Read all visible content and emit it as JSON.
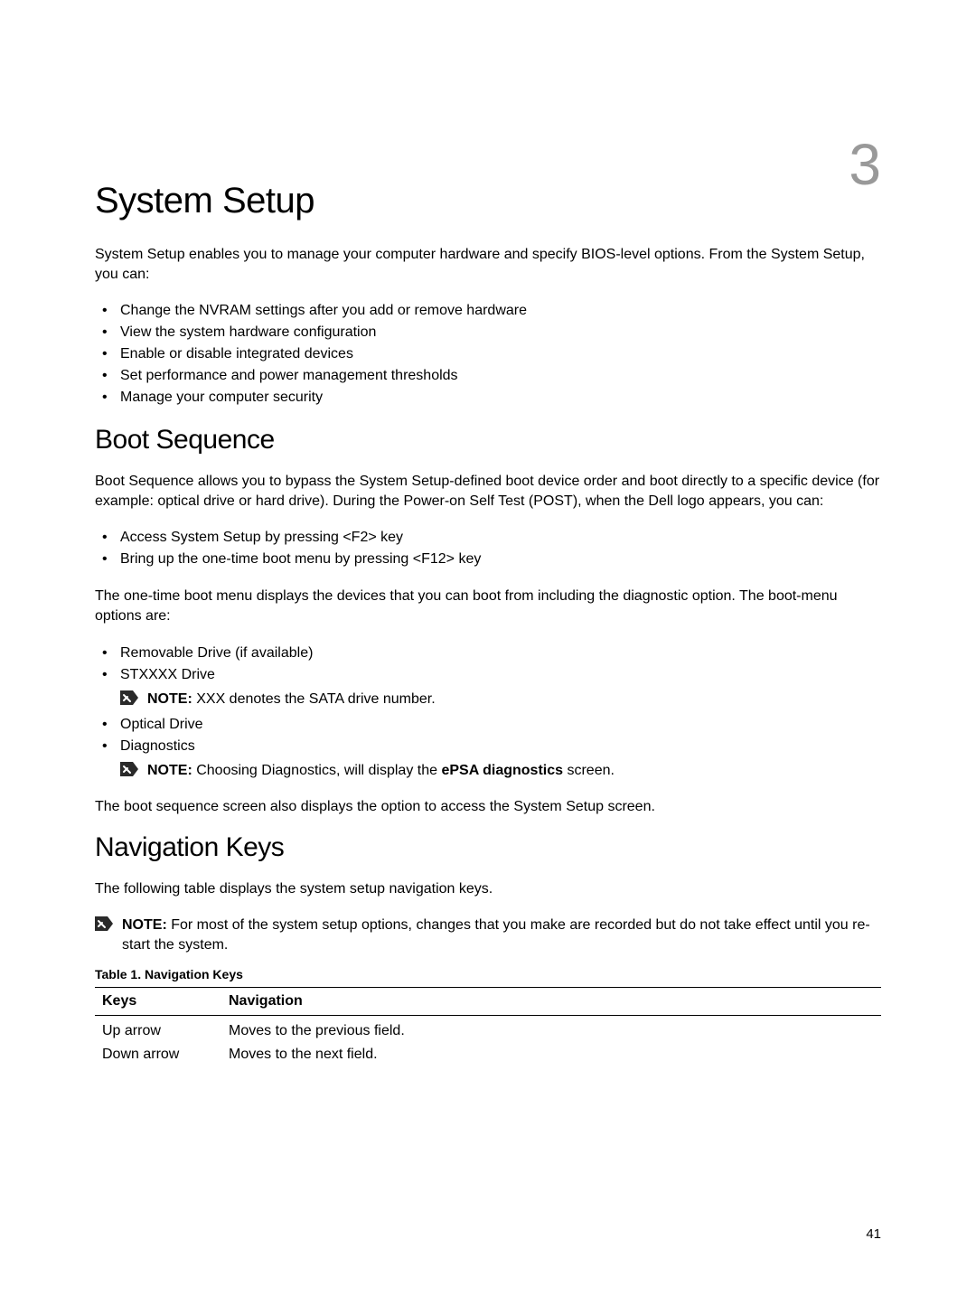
{
  "chapterNumber": "3",
  "chapterTitle": "System Setup",
  "introPara": "System Setup enables you to manage your computer hardware and specify BIOS-level options. From the System Setup, you can:",
  "introBullets": [
    "Change the NVRAM settings after you add or remove hardware",
    "View the system hardware configuration",
    "Enable or disable integrated devices",
    "Set performance and power management thresholds",
    "Manage your computer security"
  ],
  "bootSequence": {
    "heading": "Boot Sequence",
    "para1": "Boot Sequence allows you to bypass the System Setup-defined boot device order and boot directly to a specific device (for example: optical drive or hard drive). During the Power-on Self Test (POST), when the Dell logo appears, you can:",
    "bullets1": [
      "Access System Setup by pressing <F2> key",
      "Bring up the one-time boot menu by pressing <F12> key"
    ],
    "para2": "The one-time boot menu displays the devices that you can boot from including the diagnostic option. The boot-menu options are:",
    "bullets2": {
      "item1": "Removable Drive (if available)",
      "item2": "STXXXX Drive",
      "note1Label": "NOTE: ",
      "note1Text": "XXX denotes the SATA drive number.",
      "item3": "Optical Drive",
      "item4": "Diagnostics",
      "note2Label": "NOTE: ",
      "note2TextA": "Choosing Diagnostics, will display the ",
      "note2TextBold": "ePSA diagnostics",
      "note2TextB": " screen."
    },
    "para3": "The boot sequence screen also displays the option to access the System Setup screen."
  },
  "navKeys": {
    "heading": "Navigation Keys",
    "para1": "The following table displays the system setup navigation keys.",
    "noteLabel": "NOTE: ",
    "noteText": "For most of the system setup options, changes that you make are recorded but do not take effect until you re-start the system.",
    "tableCaption": "Table 1. Navigation Keys",
    "headers": {
      "col1": "Keys",
      "col2": "Navigation"
    },
    "rows": [
      {
        "key": "Up arrow",
        "nav": "Moves to the previous field."
      },
      {
        "key": "Down arrow",
        "nav": "Moves to the next field."
      }
    ]
  },
  "pageNumber": "41"
}
